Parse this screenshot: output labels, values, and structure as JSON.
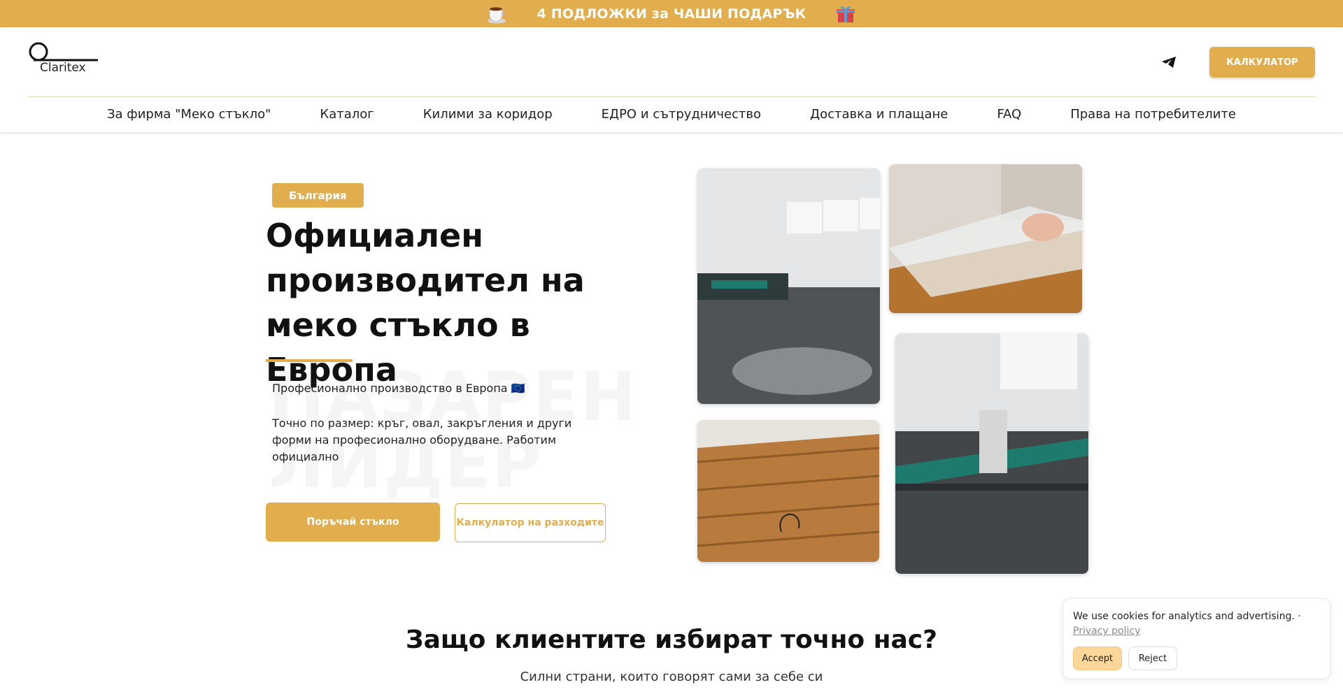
{
  "promo": {
    "left_icon": "coffee-cup-icon",
    "text": "4 ПОДЛОЖКИ за ЧАШИ ПОДАРЪК",
    "right_icon": "gift-icon"
  },
  "header": {
    "logo_text": "Claritex",
    "telegram_icon": "telegram-icon",
    "calculator_label": "КАЛКУЛАТОР"
  },
  "nav": {
    "items": [
      {
        "label": "За фирма \"Меко стъкло\""
      },
      {
        "label": "Каталог"
      },
      {
        "label": "Килими за коридор"
      },
      {
        "label": "ЕДРО и сътрудничество"
      },
      {
        "label": "Доставка и плащане"
      },
      {
        "label": "FAQ"
      },
      {
        "label": "Права на потребителите"
      }
    ]
  },
  "hero": {
    "badge": "България",
    "title": "Официален производител на меко стъкло в Европа",
    "watermark_line1": "ПАЗАРЕН",
    "watermark_line2": "ЛИДЕР",
    "paragraph1": "Професионално производство в Европа 🇪🇺",
    "paragraph2": "Точно по размер: кръг, овал, закръгления и други форми на професионално оборудване. Работим официално",
    "order_button": "Поръчай стъкло",
    "costs_button": "Калкулатор на разходите"
  },
  "colors": {
    "accent": "#e2ad4c",
    "accent_light": "#fbd89a"
  },
  "why": {
    "title": "Защо клиентите избират точно нас?",
    "subtitle": "Силни страни, които говорят сами за себе си"
  },
  "cookie": {
    "text": "We use cookies for analytics and advertising. · ",
    "link": "Privacy policy",
    "accept": "Accept",
    "reject": "Reject"
  }
}
